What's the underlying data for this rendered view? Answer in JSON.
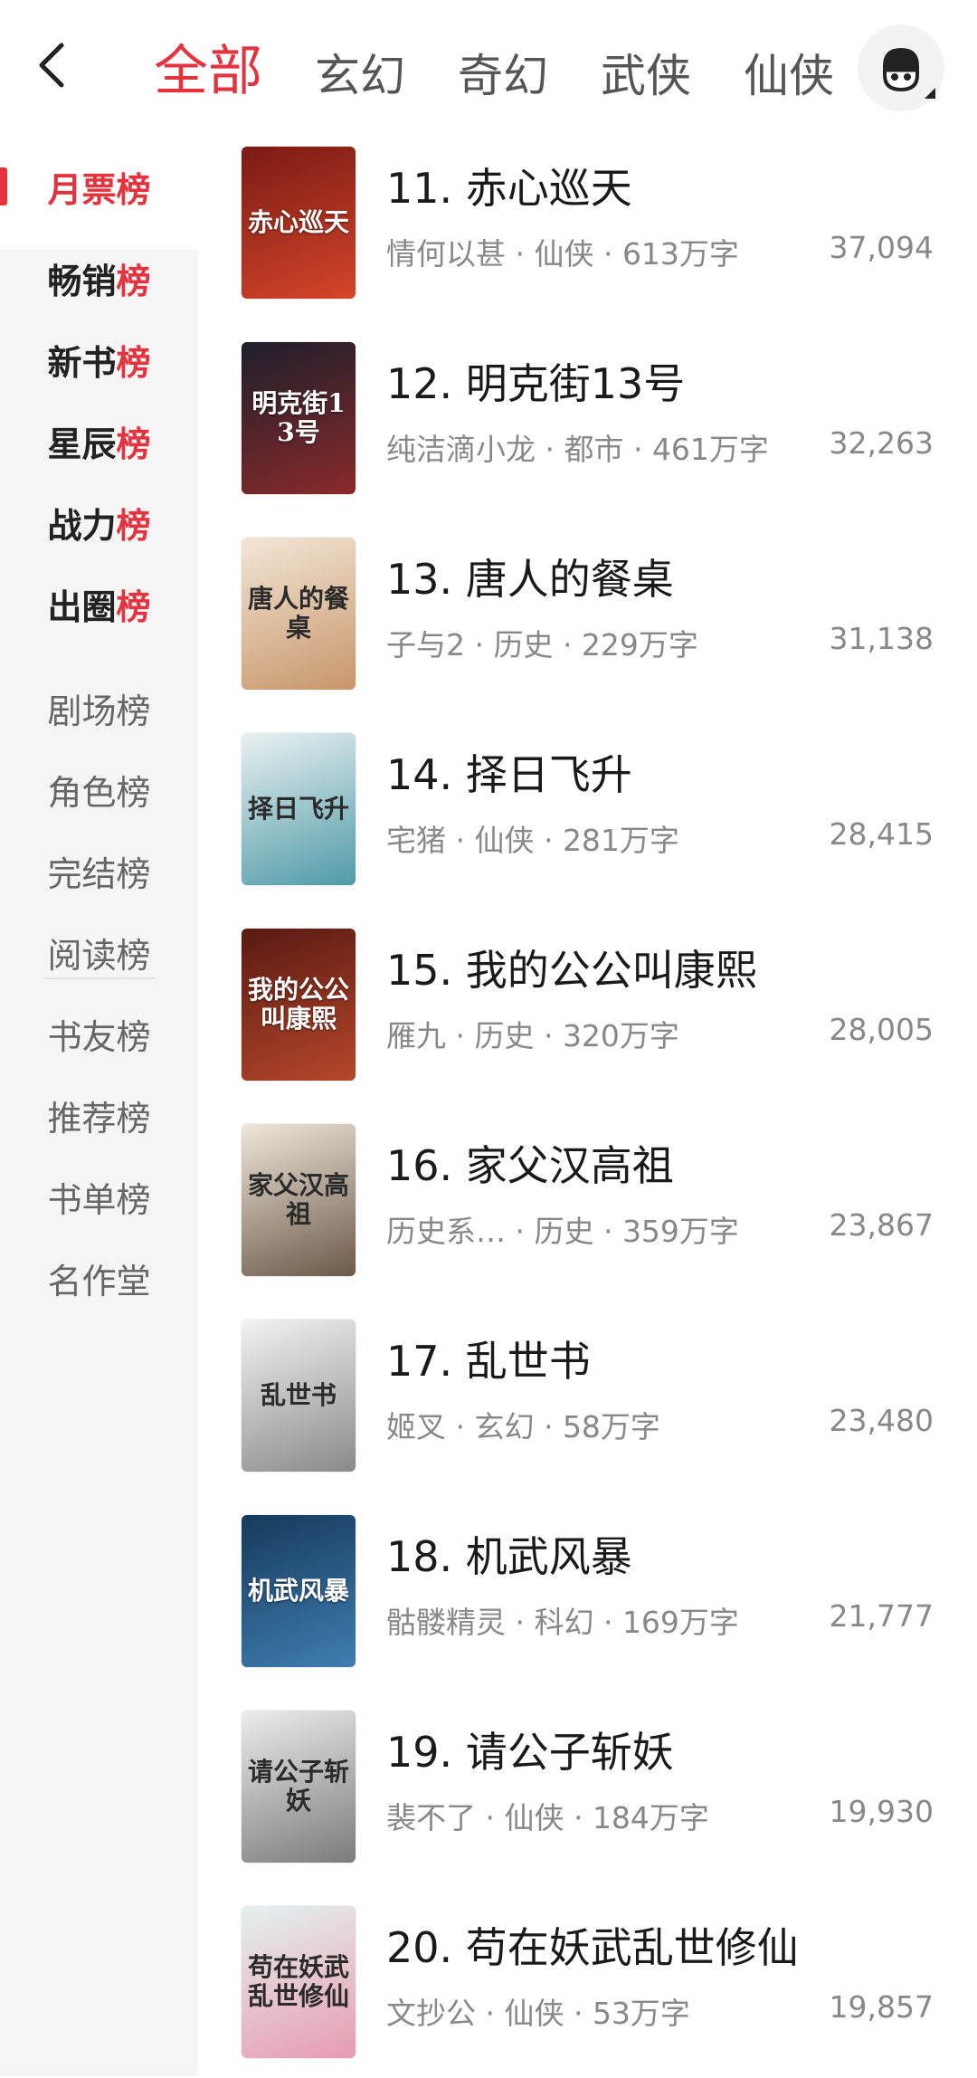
{
  "header": {
    "tabs": [
      "全部",
      "玄幻",
      "奇幻",
      "武侠",
      "仙侠"
    ],
    "active_tab": 0
  },
  "sidebar": {
    "items": [
      {
        "prefix": "月票",
        "suffix": "榜",
        "style": "active"
      },
      {
        "prefix": "畅销",
        "suffix": "榜",
        "style": "strong"
      },
      {
        "prefix": "新书",
        "suffix": "榜",
        "style": "strong"
      },
      {
        "prefix": "星辰",
        "suffix": "榜",
        "style": "strong"
      },
      {
        "prefix": "战力",
        "suffix": "榜",
        "style": "strong"
      },
      {
        "prefix": "出圈",
        "suffix": "榜",
        "style": "strong"
      },
      {
        "prefix": "剧场榜",
        "suffix": "",
        "style": "normal"
      },
      {
        "prefix": "角色榜",
        "suffix": "",
        "style": "normal"
      },
      {
        "prefix": "完结榜",
        "suffix": "",
        "style": "normal"
      },
      {
        "prefix": "阅读榜",
        "suffix": "",
        "style": "normal"
      },
      {
        "prefix": "书友榜",
        "suffix": "",
        "style": "normal"
      },
      {
        "prefix": "推荐榜",
        "suffix": "",
        "style": "normal"
      },
      {
        "prefix": "书单榜",
        "suffix": "",
        "style": "normal"
      },
      {
        "prefix": "名作堂",
        "suffix": "",
        "style": "normal"
      }
    ]
  },
  "books": [
    {
      "title": "11. 赤心巡天",
      "meta": "情何以甚 · 仙侠 · 613万字",
      "count": "37,094",
      "cover_text": "赤心巡天",
      "cover_bg": "#7a1b14",
      "cover_accent": "#d4452a",
      "cover_dark_text": false
    },
    {
      "title": "12. 明克街13号",
      "meta": "纯洁滴小龙 · 都市 · 461万字",
      "count": "32,263",
      "cover_text": "明克街13号",
      "cover_bg": "#1d1f2b",
      "cover_accent": "#8a2a2a",
      "cover_dark_text": false
    },
    {
      "title": "13. 唐人的餐桌",
      "meta": "子与2 · 历史 · 229万字",
      "count": "31,138",
      "cover_text": "唐人的餐桌",
      "cover_bg": "#f3e6d6",
      "cover_accent": "#c7966a",
      "cover_dark_text": true
    },
    {
      "title": "14. 择日飞升",
      "meta": "宅猪 · 仙侠 · 281万字",
      "count": "28,415",
      "cover_text": "择日飞升",
      "cover_bg": "#e9f1f1",
      "cover_accent": "#4f9aa8",
      "cover_dark_text": true
    },
    {
      "title": "15. 我的公公叫康熙",
      "meta": "雁九 · 历史 · 320万字",
      "count": "28,005",
      "cover_text": "我的公公叫康熙",
      "cover_bg": "#5a1a12",
      "cover_accent": "#b5472b",
      "cover_dark_text": false
    },
    {
      "title": "16. 家父汉高祖",
      "meta": "历史系… · 历史 · 359万字",
      "count": "23,867",
      "cover_text": "家父汉高祖",
      "cover_bg": "#efe6da",
      "cover_accent": "#6a5a4a",
      "cover_dark_text": true
    },
    {
      "title": "17. 乱世书",
      "meta": "姬叉 · 玄幻 · 58万字",
      "count": "23,480",
      "cover_text": "乱世书",
      "cover_bg": "#f2f2f2",
      "cover_accent": "#8a8a8a",
      "cover_dark_text": true
    },
    {
      "title": "18. 机武风暴",
      "meta": "骷髅精灵 · 科幻 · 169万字",
      "count": "21,777",
      "cover_text": "机武风暴",
      "cover_bg": "#163a5c",
      "cover_accent": "#3f7eb0",
      "cover_dark_text": false
    },
    {
      "title": "19. 请公子斩妖",
      "meta": "裴不了 · 仙侠 · 184万字",
      "count": "19,930",
      "cover_text": "请公子斩妖",
      "cover_bg": "#ececec",
      "cover_accent": "#7b7b7b",
      "cover_dark_text": true
    },
    {
      "title": "20. 苟在妖武乱世修仙",
      "meta": "文抄公 · 仙侠 · 53万字",
      "count": "19,857",
      "cover_text": "苟在妖武乱世修仙",
      "cover_bg": "#e4f2ef",
      "cover_accent": "#e79bb0",
      "cover_dark_text": true
    }
  ],
  "colors": {
    "accent": "#e2333f",
    "sidebar_bg": "#f5f5f5",
    "meta_text": "#888888"
  }
}
